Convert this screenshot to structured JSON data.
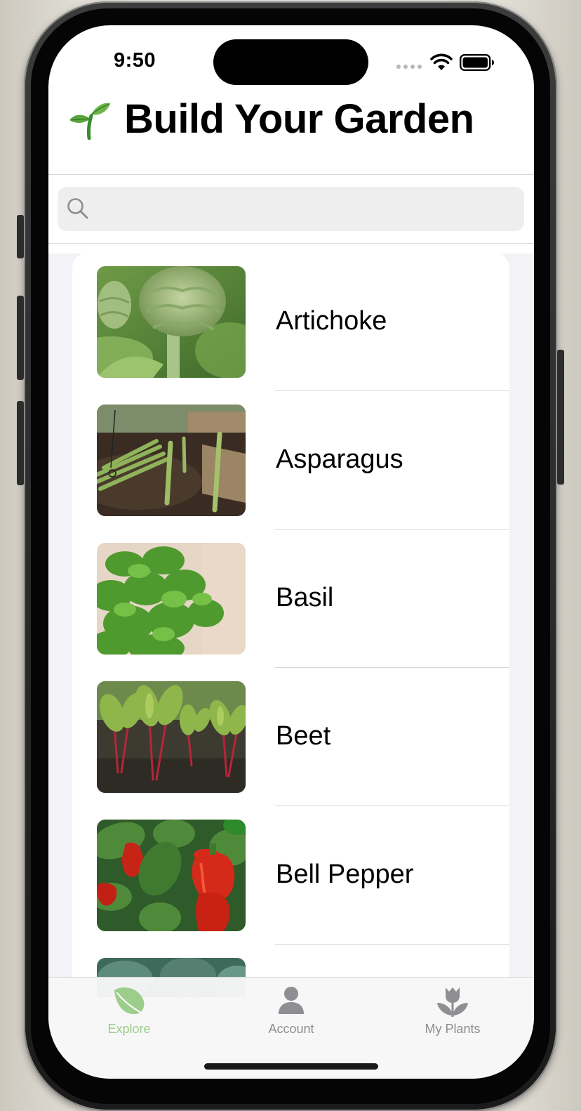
{
  "status_bar": {
    "time": "9:50"
  },
  "header": {
    "title": "Build Your Garden",
    "icon": "seedling-emoji"
  },
  "search": {
    "placeholder": "",
    "value": ""
  },
  "plants": [
    {
      "name": "Artichoke"
    },
    {
      "name": "Asparagus"
    },
    {
      "name": "Basil"
    },
    {
      "name": "Beet"
    },
    {
      "name": "Bell Pepper"
    }
  ],
  "tabs": [
    {
      "label": "Explore",
      "icon": "leaf-icon",
      "selected": true
    },
    {
      "label": "Account",
      "icon": "person-icon",
      "selected": false
    },
    {
      "label": "My Plants",
      "icon": "tulip-icon",
      "selected": false
    }
  ],
  "colors": {
    "accent": "#9ccd8a",
    "tab_inactive": "#8e8e93",
    "list_background": "#f2f2f7",
    "search_background": "#eeeeef"
  }
}
